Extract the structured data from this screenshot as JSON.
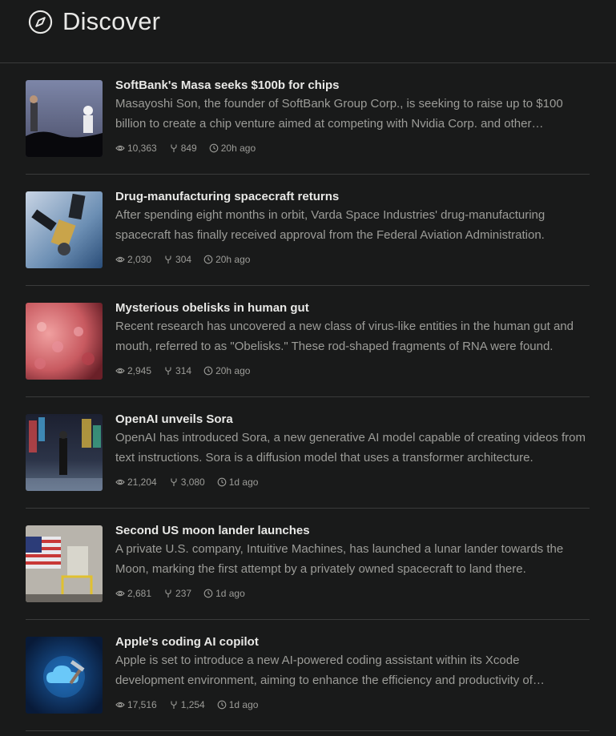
{
  "header": {
    "title": "Discover",
    "icon": "compass-icon"
  },
  "items": [
    {
      "title": "SoftBank's Masa seeks $100b for chips",
      "description": "Masayoshi Son, the founder of SoftBank Group Corp., is seeking to raise up to $100 billion to create a chip venture aimed at competing with Nvidia Corp. and other chipmakers.",
      "views": "10,363",
      "forks": "849",
      "time": "20h ago"
    },
    {
      "title": "Drug-manufacturing spacecraft returns",
      "description": "After spending eight months in orbit, Varda Space Industries' drug-manufacturing spacecraft has finally received approval from the Federal Aviation Administration.",
      "views": "2,030",
      "forks": "304",
      "time": "20h ago"
    },
    {
      "title": "Mysterious obelisks in human gut",
      "description": "Recent research has uncovered a new class of virus-like entities in the human gut and mouth, referred to as \"Obelisks.\" These rod-shaped fragments of RNA were found.",
      "views": "2,945",
      "forks": "314",
      "time": "20h ago"
    },
    {
      "title": "OpenAI unveils Sora",
      "description": "OpenAI has introduced Sora, a new generative AI model capable of creating videos from text instructions. Sora is a diffusion model that uses a transformer architecture.",
      "views": "21,204",
      "forks": "3,080",
      "time": "1d ago"
    },
    {
      "title": "Second US moon lander launches",
      "description": "A private U.S. company, Intuitive Machines, has launched a lunar lander towards the Moon, marking the first attempt by a privately owned spacecraft to land there.",
      "views": "2,681",
      "forks": "237",
      "time": "1d ago"
    },
    {
      "title": "Apple's coding AI copilot",
      "description": "Apple is set to introduce a new AI-powered coding assistant within its Xcode development environment, aiming to enhance the efficiency and productivity of developers.",
      "views": "17,516",
      "forks": "1,254",
      "time": "1d ago"
    }
  ]
}
